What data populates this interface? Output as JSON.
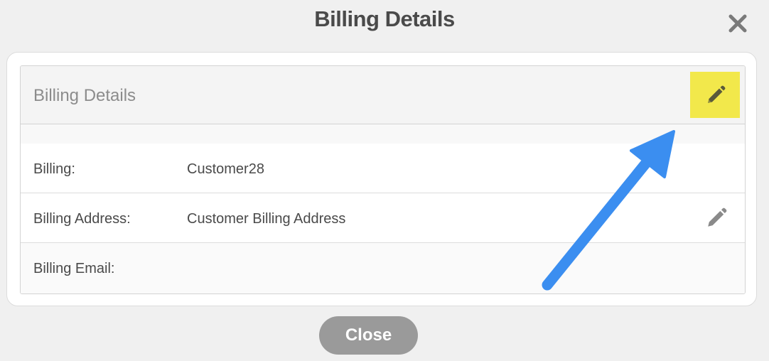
{
  "modal": {
    "title": "Billing Details",
    "close_button_label": "Close"
  },
  "panel": {
    "title": "Billing Details",
    "rows": [
      {
        "label": "Billing:",
        "value": "Customer28"
      },
      {
        "label": "Billing Address:",
        "value": "Customer Billing Address"
      },
      {
        "label": "Billing Email:",
        "value": ""
      }
    ]
  },
  "icons": {
    "close": "close-icon",
    "edit": "pencil-icon"
  },
  "colors": {
    "highlight": "#f2e84b",
    "annotation_arrow": "#3b8ef0",
    "close_button": "#9a9a9a"
  }
}
